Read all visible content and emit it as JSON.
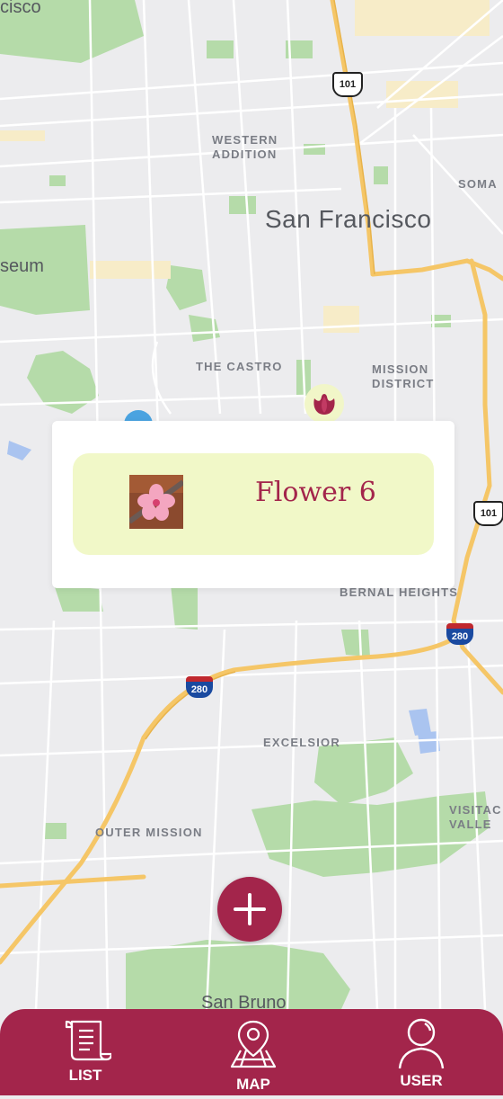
{
  "map": {
    "labels": {
      "cisco": "cisco",
      "western_addition": "WESTERN\nADDITION",
      "soma": "SOMA",
      "san_francisco": "San Francisco",
      "seum": "seum",
      "the_castro": "THE CASTRO",
      "mission_district": "MISSION\nDISTRICT",
      "bernal_heights": "BERNAL HEIGHTS",
      "excelsior": "EXCELSIOR",
      "outer_mission": "OUTER MISSION",
      "visitac": "VISITAC\nVALLE",
      "san_bruno": "San Bruno"
    },
    "shields": {
      "us101_top": "101",
      "us101_right": "101",
      "i280_left": "280",
      "i280_right": "280"
    }
  },
  "popup": {
    "flower_name": "Flower 6",
    "thumbnail_icon": "flower-thumbnail"
  },
  "fab": {
    "icon": "plus-icon"
  },
  "tabbar": {
    "tabs": [
      {
        "label": "LIST",
        "icon": "scroll-icon"
      },
      {
        "label": "MAP",
        "icon": "map-pin-icon"
      },
      {
        "label": "USER",
        "icon": "user-icon"
      }
    ]
  },
  "colors": {
    "accent": "#a3254b",
    "card_bg": "#f1f8c8",
    "park": "#a8d5a2",
    "water": "#aac4f0",
    "highway": "#f5c667"
  }
}
